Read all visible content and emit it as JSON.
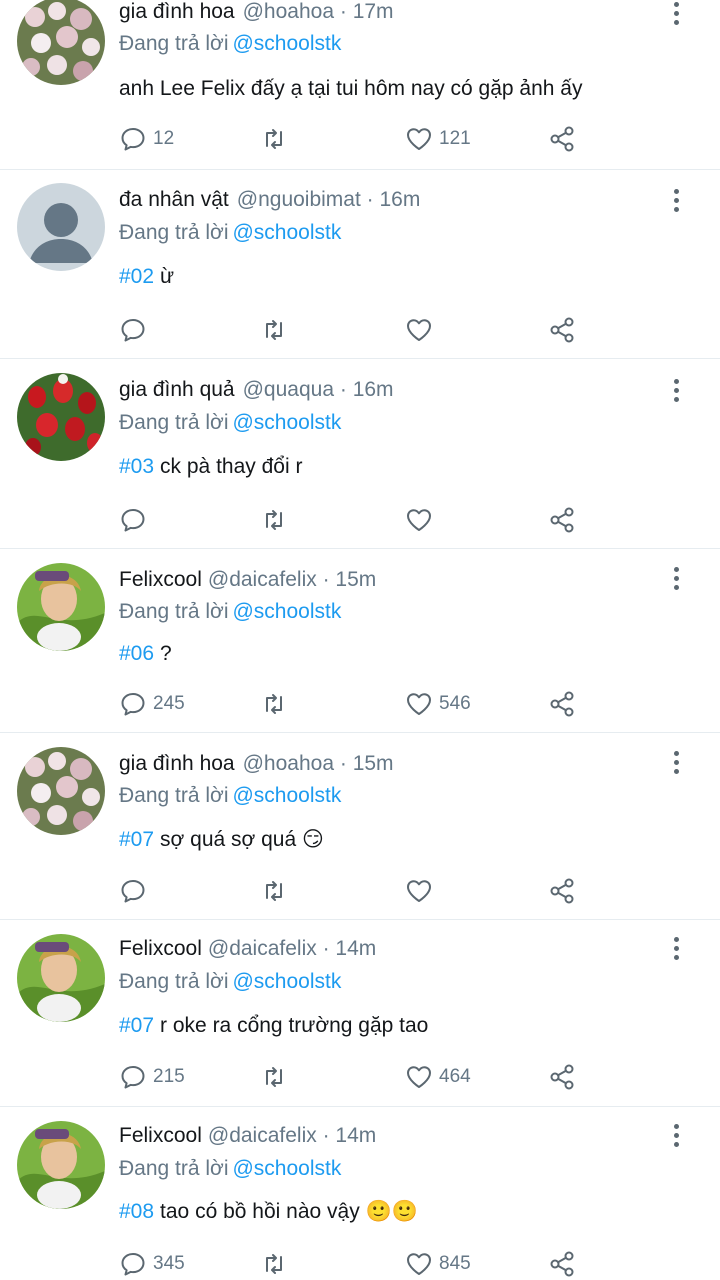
{
  "tweets": [
    {
      "name": "gia đình hoa",
      "handle": "@hoahoa",
      "time": "17m",
      "reply_label": "Đang trả lời",
      "reply_to": "@schoolstk",
      "hashtag": "",
      "text": "anh Lee Felix đấy ạ tại tui hôm nay có gặp ảnh ấy",
      "replies": "12",
      "likes": "121",
      "avatar": "flowers-avatar"
    },
    {
      "name": "đa nhân vật",
      "handle": "@nguoibimat",
      "time": "16m",
      "reply_label": "Đang trả lời",
      "reply_to": "@schoolstk",
      "hashtag": "#02",
      "text": "ừ",
      "replies": "",
      "likes": "",
      "avatar": "default-avatar"
    },
    {
      "name": "gia đình quả",
      "handle": "@quaqua",
      "time": "16m",
      "reply_label": "Đang trả lời",
      "reply_to": "@schoolstk",
      "hashtag": "#03",
      "text": "ck pà thay đổi r",
      "replies": "",
      "likes": "",
      "avatar": "strawberry-avatar"
    },
    {
      "name": "Felixcool",
      "handle": "@daicafelix",
      "time": "15m",
      "reply_label": "Đang trả lời",
      "reply_to": "@schoolstk",
      "hashtag": "#06",
      "text": "?",
      "replies": "245",
      "likes": "546",
      "avatar": "felix-avatar"
    },
    {
      "name": "gia đình hoa",
      "handle": "@hoahoa",
      "time": "15m",
      "reply_label": "Đang trả lời",
      "reply_to": "@schoolstk",
      "hashtag": "#07",
      "text": "sợ quá sợ quá 😏",
      "replies": "",
      "likes": "",
      "avatar": "flowers-avatar"
    },
    {
      "name": "Felixcool",
      "handle": "@daicafelix",
      "time": "14m",
      "reply_label": "Đang trả lời",
      "reply_to": "@schoolstk",
      "hashtag": "#07",
      "text": "r oke ra cổng trường gặp tao",
      "replies": "215",
      "likes": "464",
      "avatar": "felix-avatar"
    },
    {
      "name": "Felixcool",
      "handle": "@daicafelix",
      "time": "14m",
      "reply_label": "Đang trả lời",
      "reply_to": "@schoolstk",
      "hashtag": "#08",
      "text": "tao có bồ hồi nào vậy 🙂🙂",
      "replies": "345",
      "likes": "845",
      "avatar": "felix-avatar"
    }
  ],
  "colors": {
    "accent": "#1d9bf0",
    "muted": "#657786",
    "divider": "#e6ecf0"
  }
}
